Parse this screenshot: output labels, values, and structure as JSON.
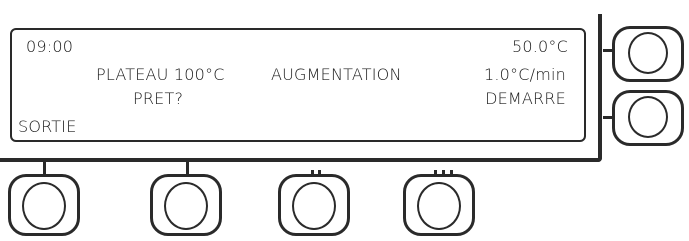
{
  "display": {
    "time": "09:00",
    "current_temp": "50.0°C",
    "plateau_label": "PLATEAU 100°C",
    "ramp_label": "AUGMENTATION",
    "ramp_rate": "1.0°C/min",
    "ready_prompt": "PRET?",
    "start_label": "DEMARRE",
    "exit_label": "SORTIE"
  },
  "softkeys": {
    "bottom": [
      {
        "id": "softkey-1",
        "marker": "|"
      },
      {
        "id": "softkey-2",
        "marker": "|"
      },
      {
        "id": "softkey-3",
        "marker": "||"
      },
      {
        "id": "softkey-4",
        "marker": "|||"
      }
    ],
    "right": [
      {
        "id": "side-key-top",
        "marker": "-"
      },
      {
        "id": "side-key-bottom",
        "marker": "-"
      }
    ]
  },
  "colors": {
    "line": "#2a2a2a",
    "background": "#ffffff",
    "text": "#1a1a1a"
  }
}
